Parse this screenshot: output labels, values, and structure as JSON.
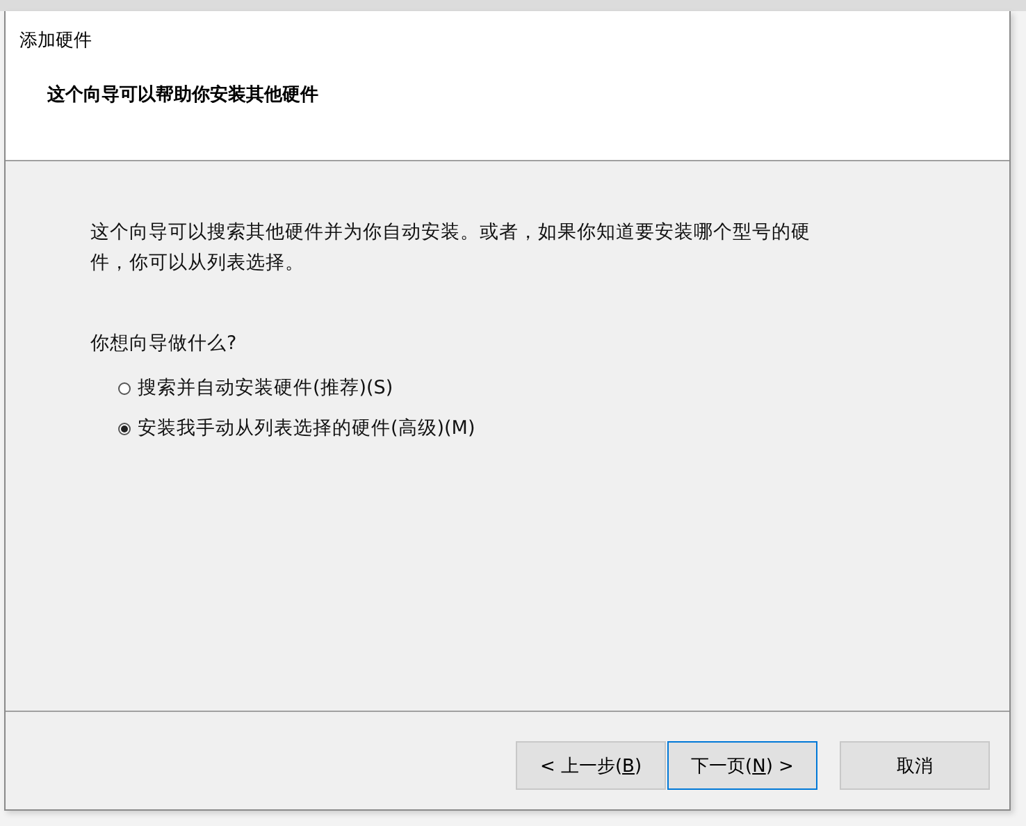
{
  "window": {
    "title": "添加硬件"
  },
  "header": {
    "heading": "这个向导可以帮助你安装其他硬件"
  },
  "body": {
    "intro": "这个向导可以搜索其他硬件并为你自动安装。或者，如果你知道要安装哪个型号的硬件，你可以从列表选择。",
    "question": "你想向导做什么?",
    "options": [
      {
        "label": "搜索并自动安装硬件(推荐)(S)",
        "selected": false
      },
      {
        "label": "安装我手动从列表选择的硬件(高级)(M)",
        "selected": true
      }
    ]
  },
  "buttons": [
    {
      "before": "< 上一步(",
      "key": "B",
      "after": ")",
      "focused": false
    },
    {
      "before": "下一页(",
      "key": "N",
      "after": ") >",
      "focused": true
    },
    {
      "before": "取消",
      "focused": false
    }
  ]
}
